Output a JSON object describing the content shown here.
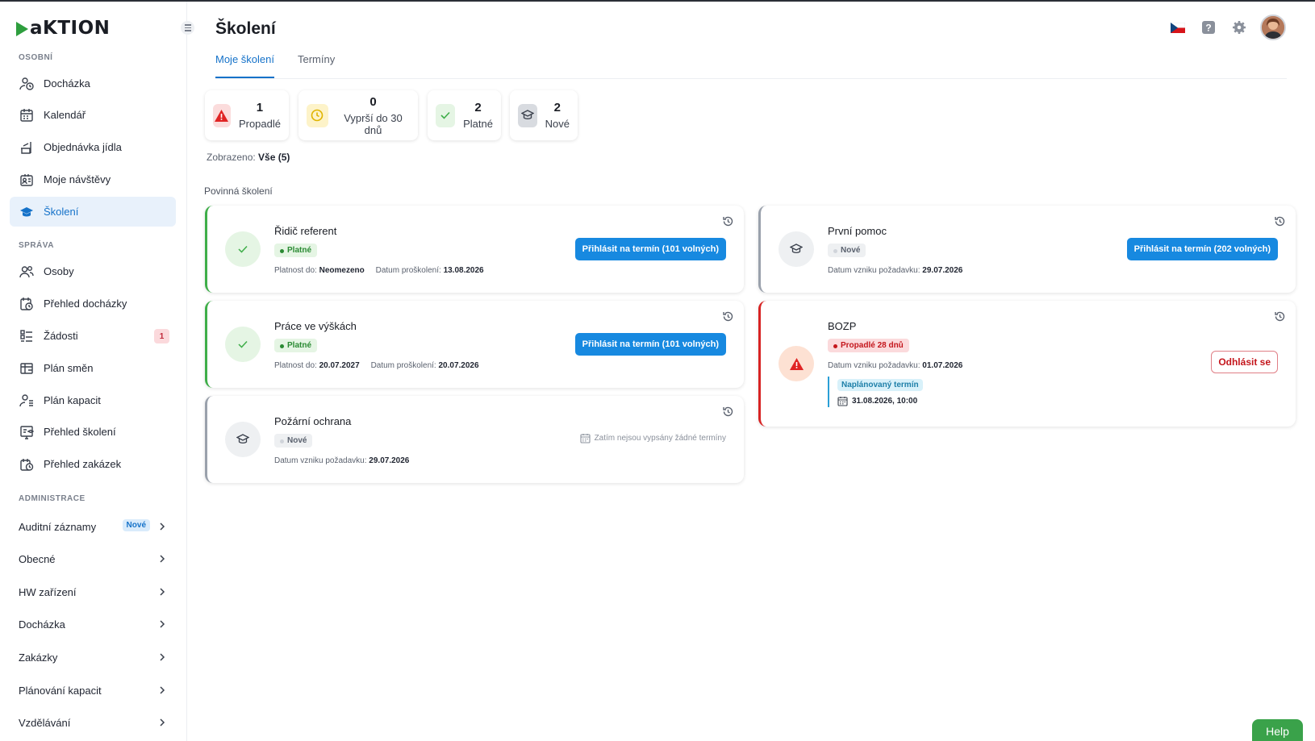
{
  "app": {
    "logo_text": "aKTION",
    "brand_color": "#2e9e3e",
    "accent_color": "#1789e0"
  },
  "sidebar": {
    "sections": {
      "personal": "OSOBNÍ",
      "management": "SPRÁVA",
      "admin": "ADMINISTRACE"
    },
    "personal_items": [
      {
        "label": "Docházka",
        "icon": "attendance-icon"
      },
      {
        "label": "Kalendář",
        "icon": "calendar-icon"
      },
      {
        "label": "Objednávka jídla",
        "icon": "meal-icon"
      },
      {
        "label": "Moje návštěvy",
        "icon": "visits-icon"
      },
      {
        "label": "Školení",
        "icon": "graduation-cap-icon",
        "active": true
      }
    ],
    "management_items": [
      {
        "label": "Osoby",
        "icon": "people-icon"
      },
      {
        "label": "Přehled docházky",
        "icon": "attendance-overview-icon"
      },
      {
        "label": "Žádosti",
        "icon": "requests-icon",
        "badge": "1"
      },
      {
        "label": "Plán směn",
        "icon": "shift-plan-icon"
      },
      {
        "label": "Plán kapacit",
        "icon": "capacity-plan-icon"
      },
      {
        "label": "Přehled školení",
        "icon": "training-overview-icon"
      },
      {
        "label": "Přehled zakázek",
        "icon": "orders-overview-icon"
      }
    ],
    "admin_items": [
      {
        "label": "Auditní záznamy",
        "badge": "Nové"
      },
      {
        "label": "Obecné"
      },
      {
        "label": "HW zařízení"
      },
      {
        "label": "Docházka"
      },
      {
        "label": "Zakázky"
      },
      {
        "label": "Plánování kapacit"
      },
      {
        "label": "Vzdělávání"
      }
    ]
  },
  "header": {
    "title": "Školení"
  },
  "tabs": [
    {
      "label": "Moje školení",
      "active": true
    },
    {
      "label": "Termíny"
    }
  ],
  "stats": [
    {
      "value": "1",
      "label": "Propadlé",
      "icon": "warning-icon",
      "color": "#e02424"
    },
    {
      "value": "0",
      "label": "Vyprší do 30 dnů",
      "icon": "clock-icon",
      "color": "#e0b400"
    },
    {
      "value": "2",
      "label": "Platné",
      "icon": "check-icon",
      "color": "#3fae49"
    },
    {
      "value": "2",
      "label": "Nové",
      "icon": "graduation-cap-icon",
      "color": "#4a505c"
    }
  ],
  "filter": {
    "prefix": "Zobrazeno:",
    "value": "Vše (5)"
  },
  "section_title": "Povinná školení",
  "labels": {
    "valid_until": "Platnost do:",
    "trained_date": "Datum proškolení:",
    "request_date": "Datum vzniku požadavku:"
  },
  "trainings": [
    {
      "title": "Řidič referent",
      "status": "Platné",
      "valid_until": "Neomezeno",
      "trained_date": "13.08.2026",
      "action": "Přihlásit na termín (101 volných)"
    },
    {
      "title": "Práce ve výškách",
      "status": "Platné",
      "valid_until": "20.07.2027",
      "trained_date": "20.07.2026",
      "action": "Přihlásit na termín (101 volných)"
    },
    {
      "title": "Požární ochrana",
      "status": "Nové",
      "request_date": "29.07.2026",
      "no_terms": "Zatím nejsou vypsány žádné termíny"
    },
    {
      "title": "První pomoc",
      "status": "Nové",
      "request_date": "29.07.2026",
      "action": "Přihlásit na termín (202 volných)"
    },
    {
      "title": "BOZP",
      "status": "Propadlé 28 dnů",
      "request_date": "01.07.2026",
      "planned_label": "Naplánovaný termín",
      "planned_date": "31.08.2026, 10:00",
      "action": "Odhlásit se"
    }
  ],
  "help": {
    "label": "Help"
  }
}
